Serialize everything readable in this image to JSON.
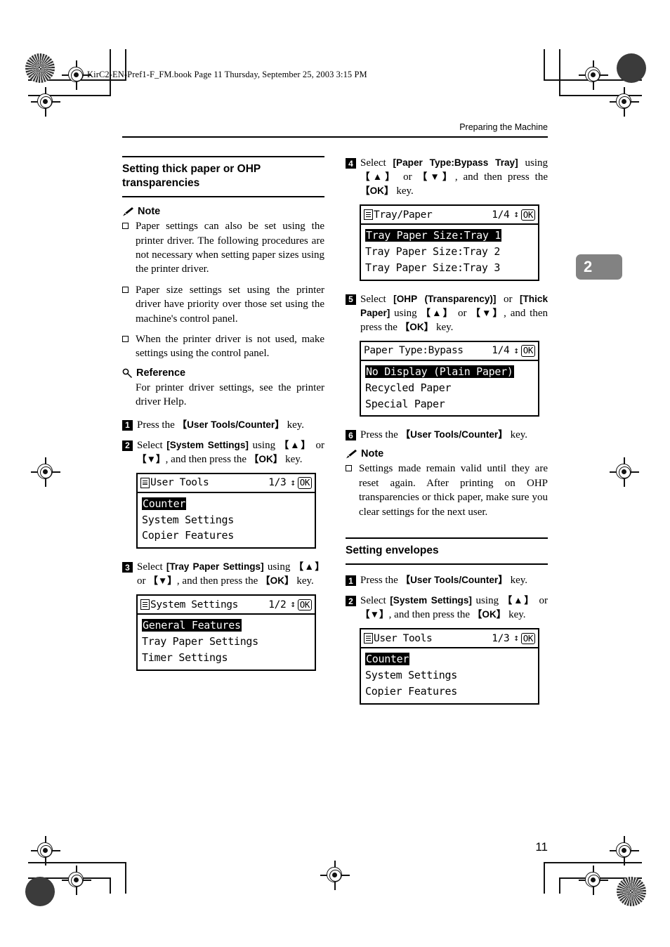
{
  "book_line": "KirC2-EN-Pref1-F_FM.book  Page 11  Thursday, September 25, 2003  3:15 PM",
  "running_head": "Preparing the Machine",
  "chapter_tab": "2",
  "page_number": "11",
  "colors": {
    "chapter_tab_bg": "#828282",
    "text": "#000000",
    "lcd_bg": "#ffffff"
  },
  "left_column": {
    "section_title": "Setting thick paper or OHP transparencies",
    "note_label": "Note",
    "notes": [
      "Paper settings can also be set using the printer driver. The following procedures are not necessary when setting paper sizes using the printer driver.",
      "Paper size settings set using the printer driver have priority over those set using the machine's control panel.",
      "When the printer driver is not used, make settings using the control panel."
    ],
    "reference_label": "Reference",
    "reference_text": "For printer driver settings, see the printer driver Help.",
    "steps": [
      {
        "num": "1",
        "parts": [
          {
            "t": "plain",
            "v": "Press the "
          },
          {
            "t": "key",
            "v": "【User Tools/Counter】"
          },
          {
            "t": "plain",
            "v": " key."
          }
        ]
      },
      {
        "num": "2",
        "parts": [
          {
            "t": "plain",
            "v": "Select "
          },
          {
            "t": "bold",
            "v": "[System Settings]"
          },
          {
            "t": "plain",
            "v": " using "
          },
          {
            "t": "key",
            "v": "【▲】"
          },
          {
            "t": "plain",
            "v": " or "
          },
          {
            "t": "key",
            "v": "【▼】"
          },
          {
            "t": "plain",
            "v": ", and then press the "
          },
          {
            "t": "key",
            "v": "【OK】"
          },
          {
            "t": "plain",
            "v": " key."
          }
        ],
        "lcd": {
          "has_menu_icon": true,
          "title": "User Tools",
          "page": "1/3",
          "updown": "↕",
          "ok": "OK",
          "rows": [
            {
              "text": "Counter",
              "selected": true
            },
            {
              "text": "System Settings",
              "selected": false
            },
            {
              "text": "Copier Features",
              "selected": false
            }
          ]
        }
      },
      {
        "num": "3",
        "parts": [
          {
            "t": "plain",
            "v": "Select "
          },
          {
            "t": "bold",
            "v": "[Tray Paper Settings]"
          },
          {
            "t": "plain",
            "v": " using "
          },
          {
            "t": "key",
            "v": "【▲】"
          },
          {
            "t": "plain",
            "v": " or "
          },
          {
            "t": "key",
            "v": "【▼】"
          },
          {
            "t": "plain",
            "v": ", and then press the "
          },
          {
            "t": "key",
            "v": "【OK】"
          },
          {
            "t": "plain",
            "v": " key."
          }
        ],
        "lcd": {
          "has_menu_icon": true,
          "title": "System Settings",
          "page": "1/2",
          "updown": "↕",
          "ok": "OK",
          "rows": [
            {
              "text": "General Features",
              "selected": true
            },
            {
              "text": "Tray Paper Settings",
              "selected": false
            },
            {
              "text": "Timer Settings",
              "selected": false
            }
          ]
        }
      }
    ]
  },
  "right_column": {
    "steps": [
      {
        "num": "4",
        "parts": [
          {
            "t": "plain",
            "v": "Select "
          },
          {
            "t": "bold",
            "v": "[Paper Type:Bypass Tray]"
          },
          {
            "t": "plain",
            "v": " using "
          },
          {
            "t": "key",
            "v": "【▲】"
          },
          {
            "t": "plain",
            "v": " or "
          },
          {
            "t": "key",
            "v": "【▼】"
          },
          {
            "t": "plain",
            "v": ", and then press the "
          },
          {
            "t": "key",
            "v": "【OK】"
          },
          {
            "t": "plain",
            "v": " key."
          }
        ],
        "lcd": {
          "has_menu_icon": true,
          "title": "Tray/Paper",
          "page": "1/4",
          "updown": "↕",
          "ok": "OK",
          "rows": [
            {
              "text": "Tray Paper Size:Tray 1",
              "selected": true
            },
            {
              "text": "Tray Paper Size:Tray 2",
              "selected": false
            },
            {
              "text": "Tray Paper Size:Tray 3",
              "selected": false
            }
          ]
        }
      },
      {
        "num": "5",
        "parts": [
          {
            "t": "plain",
            "v": "Select "
          },
          {
            "t": "bold",
            "v": "[OHP (Transparency)]"
          },
          {
            "t": "plain",
            "v": " or "
          },
          {
            "t": "bold",
            "v": "[Thick Paper]"
          },
          {
            "t": "plain",
            "v": " using "
          },
          {
            "t": "key",
            "v": "【▲】"
          },
          {
            "t": "plain",
            "v": " or "
          },
          {
            "t": "key",
            "v": "【▼】"
          },
          {
            "t": "plain",
            "v": ", and then press the "
          },
          {
            "t": "key",
            "v": "【OK】"
          },
          {
            "t": "plain",
            "v": " key."
          }
        ],
        "lcd": {
          "has_menu_icon": false,
          "title": "Paper Type:Bypass",
          "page": "1/4",
          "updown": "↕",
          "ok": "OK",
          "rows": [
            {
              "text": "No Display (Plain Paper)",
              "selected": true
            },
            {
              "text": "Recycled Paper",
              "selected": false
            },
            {
              "text": "Special Paper",
              "selected": false
            }
          ]
        }
      },
      {
        "num": "6",
        "parts": [
          {
            "t": "plain",
            "v": "Press the "
          },
          {
            "t": "key",
            "v": "【User Tools/Counter】"
          },
          {
            "t": "plain",
            "v": " key."
          }
        ]
      }
    ],
    "note_label": "Note",
    "notes": [
      "Settings made remain valid until they are reset again. After printing on OHP transparencies or thick paper, make sure you clear settings for the next user."
    ],
    "section_title": "Setting envelopes",
    "envelope_steps": [
      {
        "num": "1",
        "parts": [
          {
            "t": "plain",
            "v": "Press the "
          },
          {
            "t": "key",
            "v": "【User Tools/Counter】"
          },
          {
            "t": "plain",
            "v": " key."
          }
        ]
      },
      {
        "num": "2",
        "parts": [
          {
            "t": "plain",
            "v": "Select "
          },
          {
            "t": "bold",
            "v": "[System Settings]"
          },
          {
            "t": "plain",
            "v": " using "
          },
          {
            "t": "key",
            "v": "【▲】"
          },
          {
            "t": "plain",
            "v": " or "
          },
          {
            "t": "key",
            "v": "【▼】"
          },
          {
            "t": "plain",
            "v": ", and then press the "
          },
          {
            "t": "key",
            "v": "【OK】"
          },
          {
            "t": "plain",
            "v": " key."
          }
        ],
        "lcd": {
          "has_menu_icon": true,
          "title": "User Tools",
          "page": "1/3",
          "updown": "↕",
          "ok": "OK",
          "rows": [
            {
              "text": "Counter",
              "selected": true
            },
            {
              "text": "System Settings",
              "selected": false
            },
            {
              "text": "Copier Features",
              "selected": false
            }
          ]
        }
      }
    ]
  }
}
